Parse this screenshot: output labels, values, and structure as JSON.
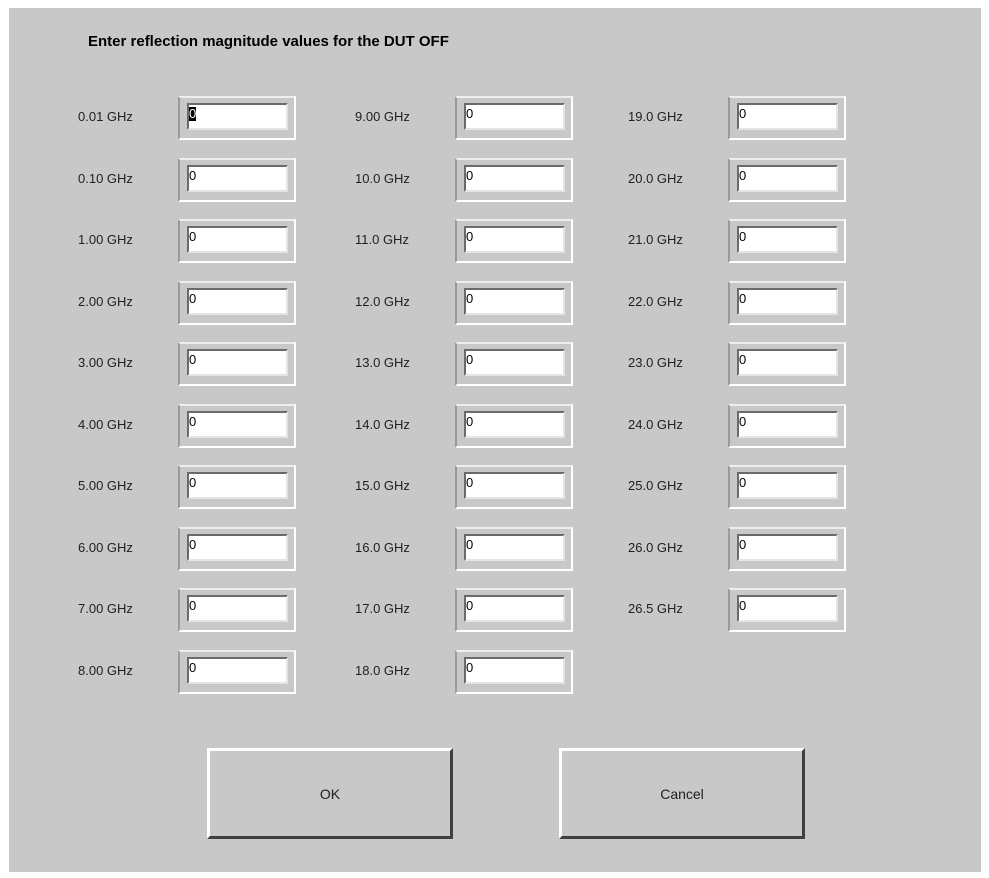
{
  "dialog": {
    "title": "Enter reflection magnitude values for the DUT OFF"
  },
  "columns": [
    [
      {
        "label": "0.01 GHz",
        "value": "0",
        "selected": true
      },
      {
        "label": "0.10 GHz",
        "value": "0"
      },
      {
        "label": "1.00 GHz",
        "value": "0"
      },
      {
        "label": "2.00 GHz",
        "value": "0"
      },
      {
        "label": "3.00 GHz",
        "value": "0"
      },
      {
        "label": "4.00 GHz",
        "value": "0"
      },
      {
        "label": "5.00 GHz",
        "value": "0"
      },
      {
        "label": "6.00 GHz",
        "value": "0"
      },
      {
        "label": "7.00 GHz",
        "value": "0"
      },
      {
        "label": "8.00 GHz",
        "value": "0"
      }
    ],
    [
      {
        "label": "9.00 GHz",
        "value": "0"
      },
      {
        "label": "10.0 GHz",
        "value": "0"
      },
      {
        "label": "11.0 GHz",
        "value": "0"
      },
      {
        "label": "12.0 GHz",
        "value": "0"
      },
      {
        "label": "13.0 GHz",
        "value": "0"
      },
      {
        "label": "14.0 GHz",
        "value": "0"
      },
      {
        "label": "15.0 GHz",
        "value": "0"
      },
      {
        "label": "16.0 GHz",
        "value": "0"
      },
      {
        "label": "17.0 GHz",
        "value": "0"
      },
      {
        "label": "18.0 GHz",
        "value": "0"
      }
    ],
    [
      {
        "label": "19.0 GHz",
        "value": "0"
      },
      {
        "label": "20.0 GHz",
        "value": "0"
      },
      {
        "label": "21.0 GHz",
        "value": "0"
      },
      {
        "label": "22.0 GHz",
        "value": "0"
      },
      {
        "label": "23.0 GHz",
        "value": "0"
      },
      {
        "label": "24.0 GHz",
        "value": "0"
      },
      {
        "label": "25.0 GHz",
        "value": "0"
      },
      {
        "label": "26.0 GHz",
        "value": "0"
      },
      {
        "label": "26.5 GHz",
        "value": "0"
      }
    ]
  ],
  "buttons": {
    "ok_label": "OK",
    "cancel_label": "Cancel"
  },
  "colors": {
    "dialog_background": "#c8c8c8",
    "page_background": "#ffffff",
    "input_background": "#ffffff"
  }
}
